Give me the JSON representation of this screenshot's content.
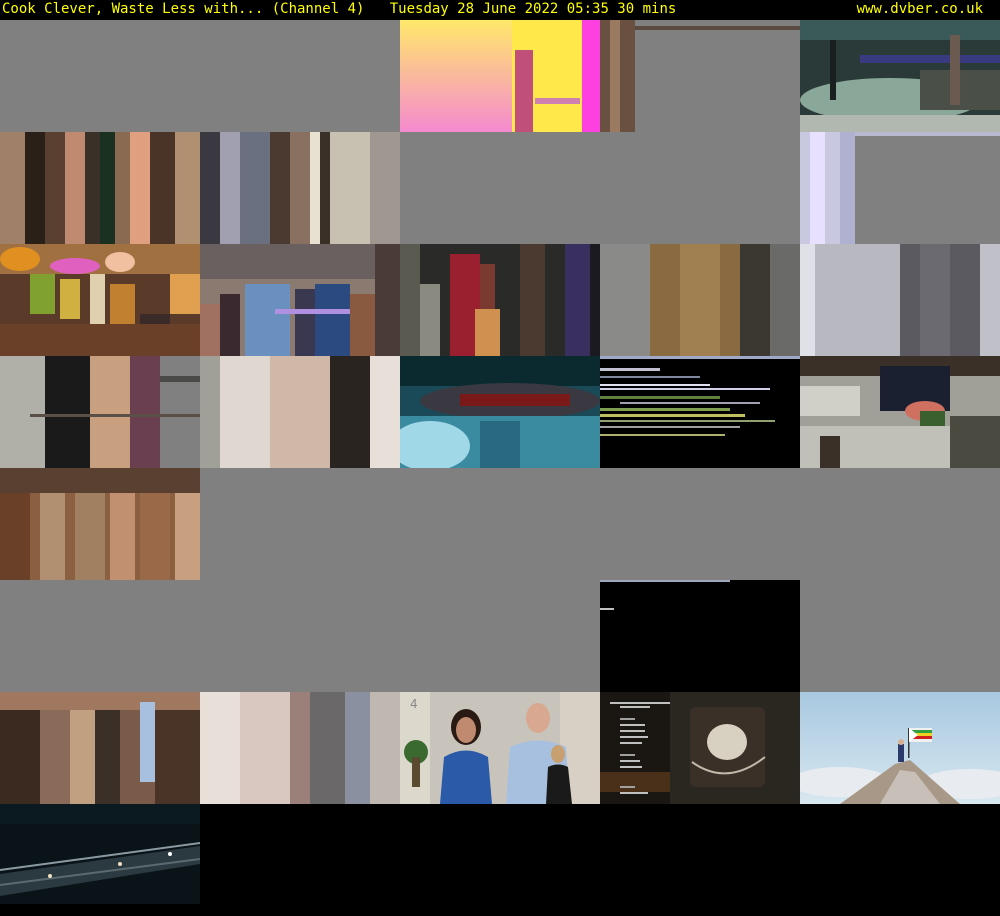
{
  "header": {
    "program": "Cook Clever, Waste Less with... (Channel 4)",
    "date_time": "Tuesday 28 June 2022  05:35  30 mins",
    "site": "www.dvber.co.uk"
  },
  "colors": {
    "header_text": "#ffff00",
    "background": "#000000",
    "empty_tile": "#808080"
  },
  "tiles": [
    {
      "kind": "empty"
    },
    {
      "kind": "empty"
    },
    {
      "kind": "pink-yellow-glitch"
    },
    {
      "kind": "gray-with-brown-bar"
    },
    {
      "kind": "dark-teal-glitch"
    },
    {
      "kind": "brown-stripes"
    },
    {
      "kind": "gray-stripes"
    },
    {
      "kind": "empty"
    },
    {
      "kind": "empty"
    },
    {
      "kind": "lavender-edge"
    },
    {
      "kind": "kitchen-colorful"
    },
    {
      "kind": "people-blur"
    },
    {
      "kind": "dark-red-stripes"
    },
    {
      "kind": "tan-stripes"
    },
    {
      "kind": "gray-panels"
    },
    {
      "kind": "purple-stripes"
    },
    {
      "kind": "beige-stripes"
    },
    {
      "kind": "blue-teal-blur"
    },
    {
      "kind": "black-glitch-lines"
    },
    {
      "kind": "kitchen-blur"
    },
    {
      "kind": "brown-blur"
    },
    {
      "kind": "empty"
    },
    {
      "kind": "empty"
    },
    {
      "kind": "empty"
    },
    {
      "kind": "empty"
    },
    {
      "kind": "empty"
    },
    {
      "kind": "empty"
    },
    {
      "kind": "empty"
    },
    {
      "kind": "black"
    },
    {
      "kind": "empty"
    },
    {
      "kind": "dark-brown-stripes"
    },
    {
      "kind": "light-stripes"
    },
    {
      "kind": "presenters"
    },
    {
      "kind": "credits"
    },
    {
      "kind": "mountain-flag"
    },
    {
      "kind": "night-road"
    }
  ]
}
